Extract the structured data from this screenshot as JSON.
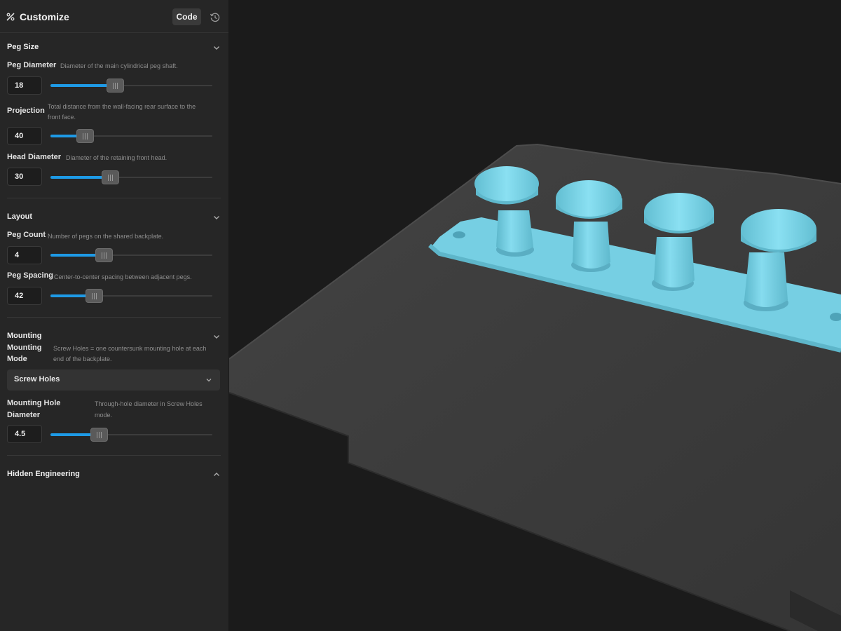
{
  "header": {
    "title": "Customize",
    "code_label": "Code"
  },
  "sections": {
    "peg_size": {
      "title": "Peg Size",
      "peg_diameter": {
        "label": "Peg Diameter",
        "desc": "Diameter of the main cylindrical peg shaft.",
        "value": "18",
        "level": 0.4
      },
      "projection": {
        "label": "Projection",
        "desc_line1": "Total distance from the wall-facing rear surface to the",
        "desc_line2": "front face.",
        "value": "40",
        "level": 0.21
      },
      "head_diameter": {
        "label": "Head Diameter",
        "desc": "Diameter of the retaining front head.",
        "value": "30",
        "level": 0.37
      }
    },
    "layout": {
      "title": "Layout",
      "peg_count": {
        "label": "Peg Count",
        "desc": "Number of pegs on the shared backplate.",
        "value": "4",
        "level": 0.33
      },
      "peg_spacing": {
        "label": "Peg Spacing",
        "desc": "Center-to-center spacing between adjacent pegs.",
        "value": "42",
        "level": 0.27
      }
    },
    "mounting": {
      "title": "Mounting",
      "mounting_mode": {
        "label_line1": "Mounting",
        "label_line2": "Mode",
        "desc_line1": "Screw Holes = one countersunk mounting hole at each",
        "desc_line2": "end of the backplate.",
        "selected": "Screw Holes"
      },
      "hole_diameter": {
        "label_line1": "Mounting Hole",
        "label_line2": "Diameter",
        "desc_line1": "Through-hole diameter in Screw Holes",
        "desc_line2": "mode.",
        "value": "4.5",
        "level": 0.3
      }
    },
    "hidden_engineering": {
      "title": "Hidden Engineering"
    }
  },
  "colors": {
    "accent": "#1e9ae6",
    "model": "#7fd3e6",
    "bed": "#3d3d3d"
  },
  "icons": {
    "customize": "wand-icon",
    "history": "history-icon",
    "expand": "chevron-down-icon",
    "collapse": "chevron-up-icon"
  }
}
